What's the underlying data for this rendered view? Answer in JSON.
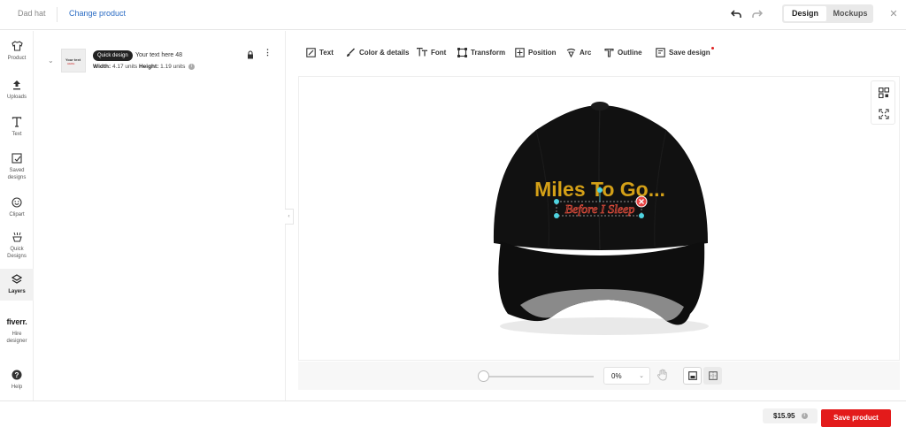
{
  "header": {
    "product_name": "Dad hat",
    "change_product": "Change product",
    "tabs": [
      "Design",
      "Mockups"
    ],
    "active_tab": "Design"
  },
  "rail": {
    "items": [
      {
        "label": "Product",
        "icon": "shirt-icon"
      },
      {
        "label": "Uploads",
        "icon": "upload-icon"
      },
      {
        "label": "Text",
        "icon": "text-icon"
      },
      {
        "label": "Saved designs",
        "icon": "saved-icon"
      },
      {
        "label": "Clipart",
        "icon": "smile-icon"
      },
      {
        "label": "Quick Designs",
        "icon": "quick-icon"
      },
      {
        "label": "Layers",
        "icon": "layers-icon",
        "active": true
      },
      {
        "label": "Hire designer",
        "icon": "fiverr-logo"
      },
      {
        "label": "Help",
        "icon": "help-icon"
      }
    ],
    "fiverr_logo_text": "fiverr."
  },
  "layer": {
    "badge": "Quick design",
    "text": "Your text here 48",
    "width_label": "Width:",
    "width_value": "4.17 units",
    "height_label": "Height:",
    "height_value": "1.19 units",
    "thumb_line1": "Your text",
    "thumb_line2": "HERE"
  },
  "toolbar": {
    "items": [
      "Text",
      "Color & details",
      "Font",
      "Transform",
      "Position",
      "Arc",
      "Outline",
      "Save design"
    ]
  },
  "canvas": {
    "hat_line1": "Miles To Go...",
    "hat_line2": "Before I Sleep",
    "hat_color": "#111111",
    "text_color": "#d4a017",
    "script_color": "#d84a3a"
  },
  "bottom": {
    "zoom_value": "0%"
  },
  "footer": {
    "price": "$15.95",
    "save_label": "Save product"
  },
  "colors": {
    "accent": "#e31b1b",
    "link": "#2b6cc4"
  }
}
